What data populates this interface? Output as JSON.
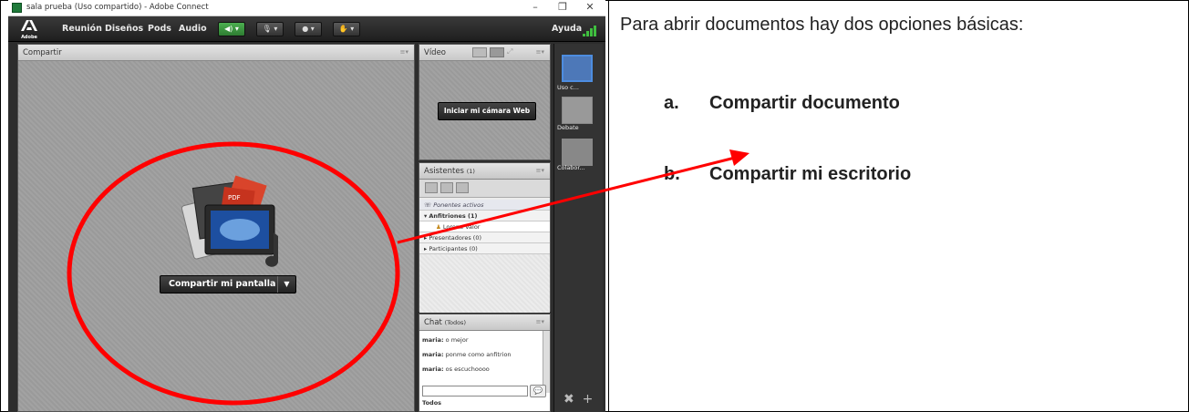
{
  "window": {
    "title": "sala prueba (Uso compartido) - Adobe Connect"
  },
  "menubar": {
    "logo": "Adobe",
    "items": [
      "Reunión",
      "Diseños",
      "Pods",
      "Audio"
    ],
    "help": "Ayuda"
  },
  "share_pod": {
    "title": "Compartir",
    "share_button": "Compartir mi pantalla"
  },
  "video_pod": {
    "title": "Vídeo",
    "start_button": "Iniciar mi cámara Web"
  },
  "attendees_pod": {
    "title": "Asistentes",
    "count": "(1)",
    "active_speakers": "Ponentes activos",
    "groups": [
      {
        "label": "Anfitriones (1)",
        "expanded": true
      },
      {
        "label": "Presentadores (0)",
        "expanded": false
      },
      {
        "label": "Participantes (0)",
        "expanded": false
      }
    ],
    "host_user": "Lorena Valor"
  },
  "chat_pod": {
    "title": "Chat",
    "scope": "(Todos)",
    "messages": [
      {
        "user": "maria:",
        "text": "o mejor"
      },
      {
        "user": "maria:",
        "text": "ponme como anfitrion"
      },
      {
        "user": "maria:",
        "text": "os escuchoooo"
      }
    ],
    "tab": "Todos"
  },
  "layouts": {
    "items": [
      "Uso c...",
      "Debate",
      "Colabor..."
    ]
  },
  "document": {
    "intro": "Para abrir documentos hay dos opciones básicas:",
    "options": [
      {
        "marker": "a.",
        "label": "Compartir documento"
      },
      {
        "marker": "b.",
        "label": "Compartir mi escritorio"
      }
    ]
  },
  "colors": {
    "annotation": "#ff0000",
    "layout_active": "#4d8de0"
  }
}
